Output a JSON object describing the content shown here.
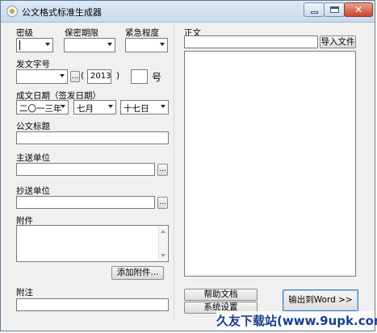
{
  "window": {
    "title": "公文格式标准生成器"
  },
  "labels": {
    "secrecy": "密级",
    "secrecy_term": "保密期限",
    "urgency": "紧急程度",
    "doc_number": "发文字号",
    "paren_open": "(",
    "paren_close": ")",
    "hao": "号",
    "date": "成文日期（签发日期）",
    "doc_title": "公文标题",
    "main_recipient": "主送单位",
    "cc_recipient": "抄送单位",
    "attachment": "附件",
    "note": "附注",
    "body": "正文"
  },
  "fields": {
    "secrecy_value": "",
    "secrecy_term_value": "",
    "urgency_value": "",
    "doc_number_prefix": "",
    "doc_year": "2013",
    "doc_seq": "",
    "date_year": "二〇一三年",
    "date_month": "七月",
    "date_day": "十七日",
    "doc_title": "",
    "main_recipient": "",
    "cc_recipient": "",
    "note": ""
  },
  "buttons": {
    "browse": "...",
    "add_attachment": "添加附件...",
    "import_file": "导入文件",
    "help": "帮助文档",
    "settings": "系统设置",
    "export_word": "输出到Word >>"
  },
  "watermark": "久友下载站(www.9upk.com)"
}
